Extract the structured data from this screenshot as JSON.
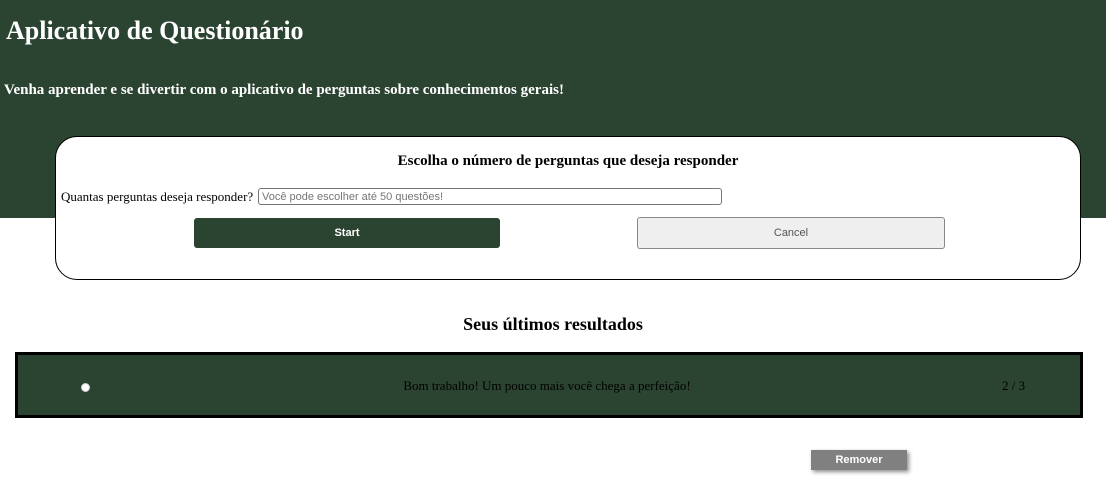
{
  "header": {
    "title": "Aplicativo de Questionário",
    "subtitle": "Venha aprender e se divertir com o aplicativo de perguntas sobre conhecimentos gerais!"
  },
  "setup": {
    "title": "Escolha o número de perguntas que deseja responder",
    "question_label": "Quantas perguntas deseja responder?",
    "question_value": "",
    "question_placeholder": "Você pode escolher até 50 questões!",
    "start_label": "Start",
    "cancel_label": "Cancel"
  },
  "results": {
    "title": "Seus últimos resultados",
    "items": [
      {
        "message": "Bom trabalho! Um pouco mais você chega a perfeição!",
        "score": "2 / 3",
        "selected": false
      }
    ],
    "remove_label": "Remover"
  },
  "colors": {
    "brand": "#2b4331",
    "remove_button": "#808080"
  }
}
